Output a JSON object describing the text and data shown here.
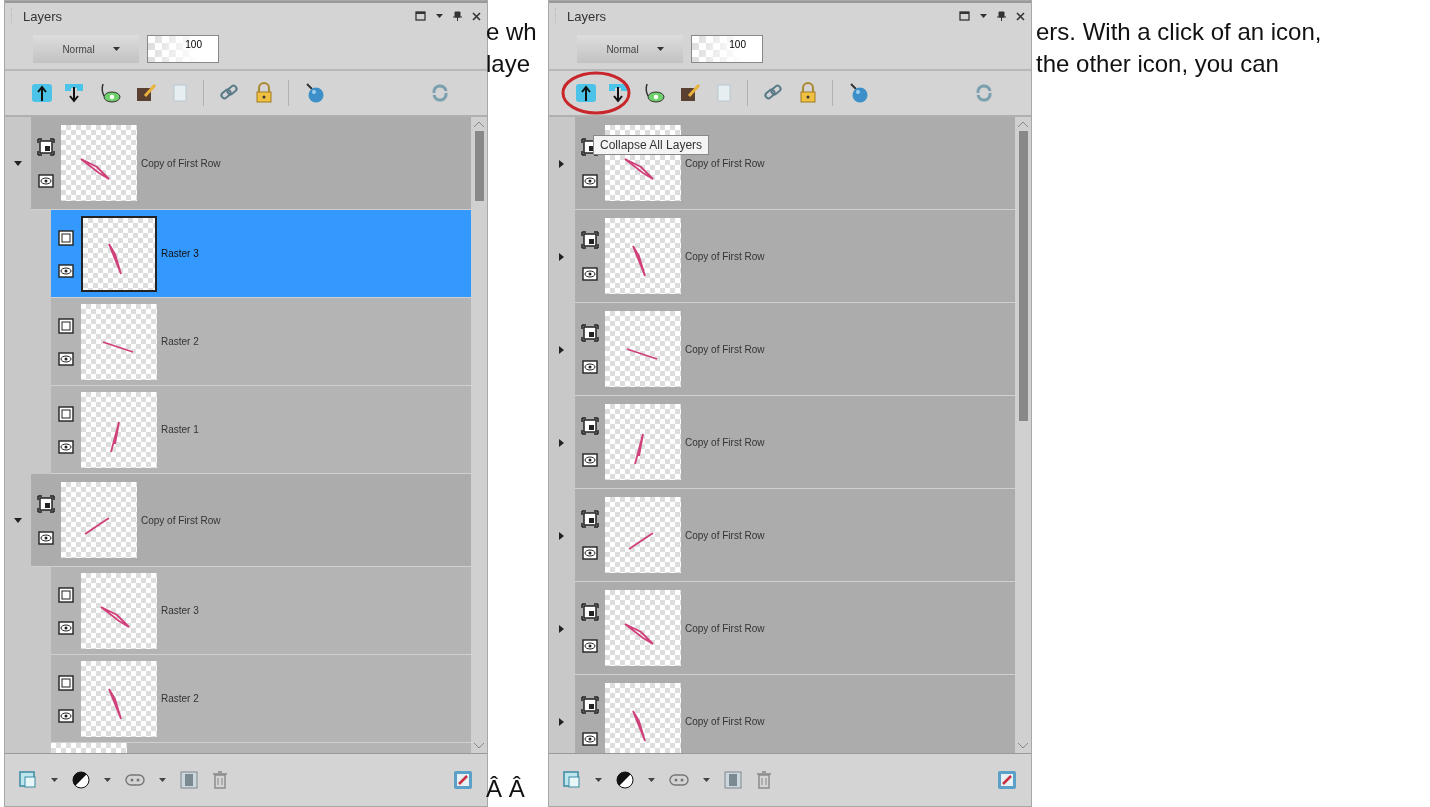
{
  "background_text": {
    "left_lines": [
      "e wh",
      "laye"
    ],
    "right_lines": [
      "ers. With a click of an icon,",
      "the other icon, you can"
    ],
    "bottom": "Â Â"
  },
  "panels": [
    {
      "title": "Layers",
      "blend_mode": "Normal",
      "opacity": "100",
      "circled": false,
      "layers": [
        {
          "kind": "group",
          "name": "Copy of First Row",
          "expanded": true,
          "selected": false,
          "children": [
            {
              "kind": "raster",
              "name": "Raster 3",
              "selected": true
            },
            {
              "kind": "raster",
              "name": "Raster 2",
              "selected": false
            },
            {
              "kind": "raster",
              "name": "Raster 1",
              "selected": false
            }
          ]
        },
        {
          "kind": "group",
          "name": "Copy of First Row",
          "expanded": true,
          "selected": false,
          "children": [
            {
              "kind": "raster",
              "name": "Raster 3",
              "selected": false
            },
            {
              "kind": "raster",
              "name": "Raster 2",
              "selected": false
            }
          ]
        }
      ]
    },
    {
      "title": "Layers",
      "blend_mode": "Normal",
      "opacity": "100",
      "circled": true,
      "tooltip": "Collapse All Layers",
      "layers": [
        {
          "kind": "group",
          "name": "Copy of First Row",
          "expanded": false,
          "selected": false
        },
        {
          "kind": "group",
          "name": "Copy of First Row",
          "expanded": false,
          "selected": false
        },
        {
          "kind": "group",
          "name": "Copy of First Row",
          "expanded": false,
          "selected": false
        },
        {
          "kind": "group",
          "name": "Copy of First Row",
          "expanded": false,
          "selected": false
        },
        {
          "kind": "group",
          "name": "Copy of First Row",
          "expanded": false,
          "selected": false
        },
        {
          "kind": "group",
          "name": "Copy of First Row",
          "expanded": false,
          "selected": false
        },
        {
          "kind": "group",
          "name": "Copy of First Row",
          "expanded": false,
          "selected": false
        }
      ]
    }
  ]
}
